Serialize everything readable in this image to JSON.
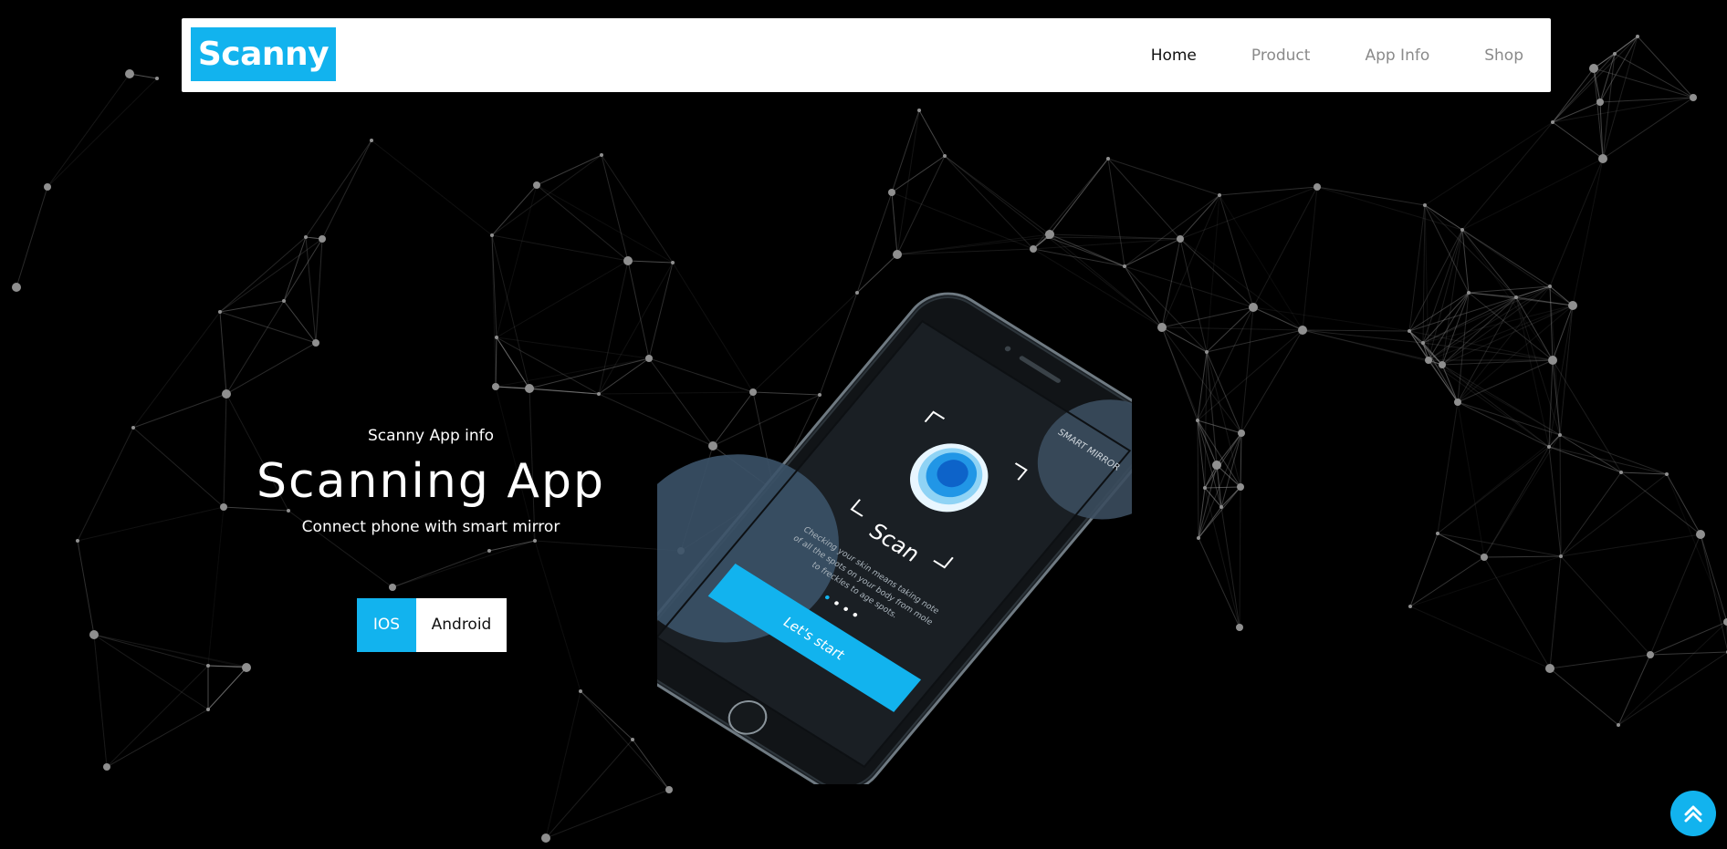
{
  "brand": {
    "name": "Scanny"
  },
  "nav": {
    "items": [
      {
        "label": "Home",
        "active": true
      },
      {
        "label": "Product",
        "active": false
      },
      {
        "label": "App Info",
        "active": false
      },
      {
        "label": "Shop",
        "active": false
      }
    ]
  },
  "hero": {
    "kicker": "Scanny App info",
    "title": "Scanning App",
    "subtitle": "Connect phone with smart mirror",
    "buttons": {
      "ios": "IOS",
      "android": "Android"
    }
  },
  "phone_screen": {
    "header": "SMART MIRROR",
    "scan_label": "Scan",
    "description_lines": [
      "Checking your skin means taking note",
      "of all the spots on your body from mole",
      "to freckles to age spots."
    ],
    "cta": "Let's start"
  },
  "colors": {
    "accent": "#12b3ee",
    "background": "#000000",
    "navbar": "#ffffff",
    "nav_inactive": "#8a8a8a",
    "nav_active": "#111111"
  },
  "icons": {
    "back_to_top": "double-chevron-up-icon"
  }
}
